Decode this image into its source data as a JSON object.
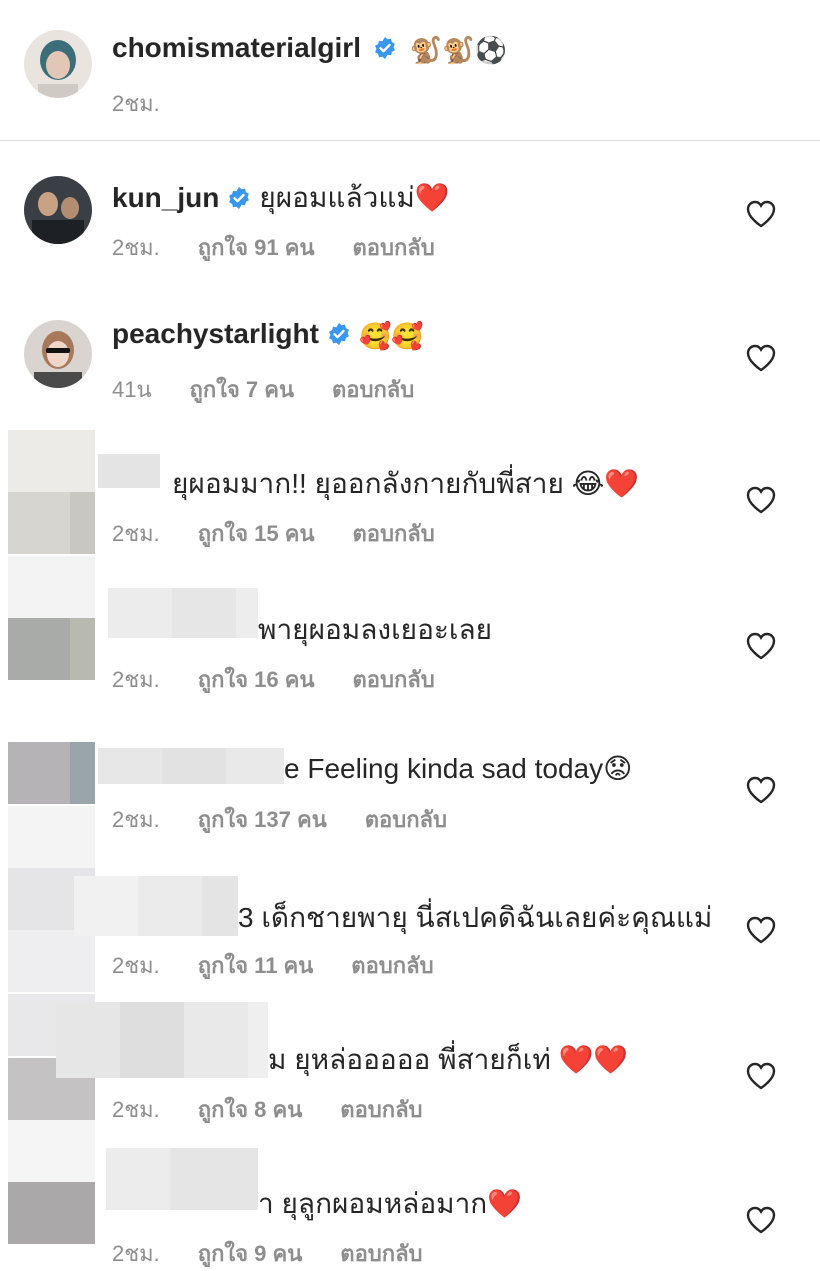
{
  "caption": {
    "username": "chomismaterialgirl",
    "text": "🐒🐒⚽",
    "time": "2ชม."
  },
  "comments": [
    {
      "username": "kun_jun",
      "verified": true,
      "text": "ยุผอมแล้วแม่❤️",
      "time": "2ชม.",
      "likes": "ถูกใจ 91 คน",
      "reply": "ตอบกลับ"
    },
    {
      "username": "peachystarlight",
      "verified": true,
      "text": "🥰🥰",
      "time": "41น",
      "likes": "ถูกใจ 7 คน",
      "reply": "ตอบกลับ"
    },
    {
      "username": "",
      "verified": false,
      "text": "ยุผอมมาก!! ยุออกลังกายกับพี่สาย 😂❤️",
      "time": "2ชม.",
      "likes": "ถูกใจ 15 คน",
      "reply": "ตอบกลับ"
    },
    {
      "username": "",
      "verified": false,
      "text": "พายุผอมลงเยอะเลย",
      "time": "2ชม.",
      "likes": "ถูกใจ 16 คน",
      "reply": "ตอบกลับ"
    },
    {
      "username": "",
      "verified": false,
      "text": "e Feeling kinda sad today😟",
      "time": "2ชม.",
      "likes": "ถูกใจ 137 คน",
      "reply": "ตอบกลับ"
    },
    {
      "username": "",
      "verified": false,
      "text": "3 เด็กชายพายุ นี่สเปคดิฉันเลยค่ะคุณแม่",
      "time": "2ชม.",
      "likes": "ถูกใจ 11 คน",
      "reply": "ตอบกลับ"
    },
    {
      "username": "",
      "verified": false,
      "text": "ม ยุหล่อออออ พี่สายก็เท่ ❤️❤️",
      "time": "2ชม.",
      "likes": "ถูกใจ 8 คน",
      "reply": "ตอบกลับ"
    },
    {
      "username": "",
      "verified": false,
      "text": "า ยุลูกผอมหล่อมาก❤️",
      "time": "2ชม.",
      "likes": "ถูกใจ 9 คน",
      "reply": "ตอบกลับ"
    }
  ],
  "colors": {
    "text": "#262626",
    "meta": "#8e8e8e",
    "verified": "#3897f0",
    "divider": "#dbdbdb"
  },
  "icons": {
    "verified": "verified-badge-icon",
    "like": "heart-outline-icon"
  }
}
